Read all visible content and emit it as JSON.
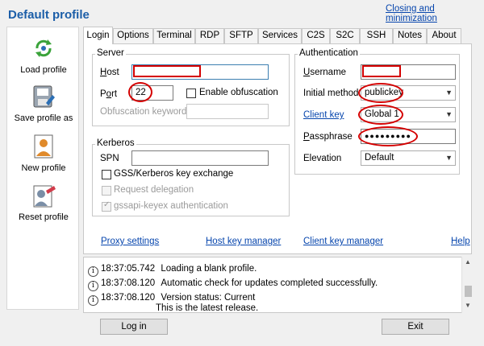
{
  "window": {
    "title": "Default profile",
    "closing_link": "Closing and minimization"
  },
  "sidebar": {
    "items": [
      {
        "label": "Load profile",
        "icon": "load-profile-icon"
      },
      {
        "label": "Save profile as",
        "icon": "save-profile-icon"
      },
      {
        "label": "New profile",
        "icon": "new-profile-icon"
      },
      {
        "label": "Reset profile",
        "icon": "reset-profile-icon"
      }
    ]
  },
  "tabs": [
    "Login",
    "Options",
    "Terminal",
    "RDP",
    "SFTP",
    "Services",
    "C2S",
    "S2C",
    "SSH",
    "Notes",
    "About"
  ],
  "active_tab": "Login",
  "server": {
    "group_title": "Server",
    "host_label": "Host",
    "host_value": "",
    "port_label": "Port",
    "port_value": "22",
    "obfuscation_label": "Enable obfuscation",
    "obfuscation_keyword_label": "Obfuscation keyword",
    "obfuscation_keyword_value": ""
  },
  "kerberos": {
    "group_title": "Kerberos",
    "spn_label": "SPN",
    "spn_value": "",
    "gss_label": "GSS/Kerberos key exchange",
    "delegation_label": "Request delegation",
    "gssapi_label": "gssapi-keyex authentication"
  },
  "auth": {
    "group_title": "Authentication",
    "username_label": "Username",
    "username_value": "",
    "method_label": "Initial method",
    "method_value": "publickey",
    "client_key_label": "Client key",
    "client_key_value": "Global 1",
    "passphrase_label": "Passphrase",
    "passphrase_value": "●●●●●●●●●",
    "elevation_label": "Elevation",
    "elevation_value": "Default"
  },
  "links": {
    "proxy": "Proxy settings",
    "hostkey": "Host key manager",
    "clientkey": "Client key manager",
    "help": "Help"
  },
  "log": {
    "entries": [
      {
        "time": "18:37:05.742",
        "message": "Loading a blank profile."
      },
      {
        "time": "18:37:08.120",
        "message": "Automatic check for updates completed successfully."
      },
      {
        "time": "18:37:08.120",
        "message": "Version status: Current",
        "message2": "This is the latest release."
      }
    ]
  },
  "buttons": {
    "login": "Log in",
    "exit": "Exit"
  },
  "colors": {
    "title": "#1c5ea8",
    "link": "#0645ad",
    "highlight": "#d40000"
  }
}
